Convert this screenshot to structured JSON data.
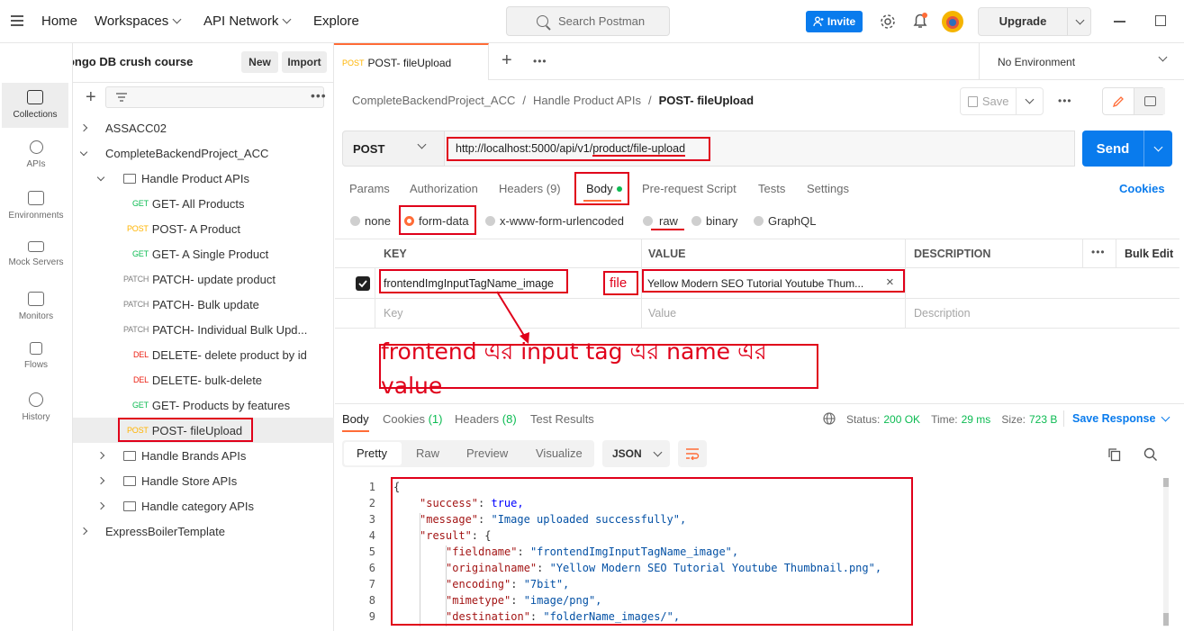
{
  "topbar": {
    "nav": [
      "Home",
      "Workspaces",
      "API Network",
      "Explore"
    ],
    "search_placeholder": "Search Postman",
    "invite": "Invite",
    "upgrade": "Upgrade"
  },
  "workspace": {
    "name": "Node Mongo DB crush course",
    "new": "New",
    "import": "Import"
  },
  "rail": [
    "Collections",
    "APIs",
    "Environments",
    "Mock Servers",
    "Monitors",
    "Flows",
    "History"
  ],
  "tree": [
    {
      "type": "collection",
      "label": "ASSACC02",
      "expanded": false
    },
    {
      "type": "collection",
      "label": "CompleteBackendProject_ACC",
      "expanded": true
    },
    {
      "type": "folder",
      "label": "Handle Product APIs",
      "expanded": true
    },
    {
      "type": "request",
      "method": "GET",
      "label": "GET- All Products"
    },
    {
      "type": "request",
      "method": "POST",
      "label": "POST- A Product"
    },
    {
      "type": "request",
      "method": "GET",
      "label": "GET- A Single Product"
    },
    {
      "type": "request",
      "method": "PATCH",
      "label": "PATCH- update product"
    },
    {
      "type": "request",
      "method": "PATCH",
      "label": "PATCH- Bulk update"
    },
    {
      "type": "request",
      "method": "PATCH",
      "label": "PATCH- Individual Bulk Upd..."
    },
    {
      "type": "request",
      "method": "DEL",
      "label": "DELETE- delete product by id"
    },
    {
      "type": "request",
      "method": "DEL",
      "label": "DELETE- bulk-delete"
    },
    {
      "type": "request",
      "method": "GET",
      "label": "GET- Products by features"
    },
    {
      "type": "request",
      "method": "POST",
      "label": "POST- fileUpload"
    },
    {
      "type": "folder",
      "label": "Handle Brands APIs",
      "expanded": false
    },
    {
      "type": "folder",
      "label": "Handle Store APIs",
      "expanded": false
    },
    {
      "type": "folder",
      "label": "Handle category APIs",
      "expanded": false
    },
    {
      "type": "collection",
      "label": "ExpressBoilerTemplate",
      "expanded": false
    }
  ],
  "tab": {
    "method": "POST",
    "title": "POST- fileUpload"
  },
  "environment": "No Environment",
  "breadcrumb": [
    "CompleteBackendProject_ACC",
    "Handle Product APIs",
    "POST- fileUpload"
  ],
  "save": "Save",
  "request": {
    "method": "POST",
    "url_prefix": "http://localhost:5000/api/v1/",
    "url_path": "product/file-upload",
    "send": "Send"
  },
  "subtabs": [
    "Params",
    "Authorization",
    "Headers (9)",
    "Body",
    "Pre-request Script",
    "Tests",
    "Settings"
  ],
  "cookies": "Cookies",
  "body_modes": [
    "none",
    "form-data",
    "x-www-form-urlencoded",
    "raw",
    "binary",
    "GraphQL"
  ],
  "table": {
    "headers": [
      "KEY",
      "VALUE",
      "DESCRIPTION",
      "Bulk Edit"
    ],
    "row": {
      "key": "frontendImgInputTagName_image",
      "type": "file",
      "value": "Yellow Modern SEO Tutorial Youtube Thum..."
    },
    "placeholders": [
      "Key",
      "Value",
      "Description"
    ]
  },
  "annotation": "frontend এর input tag এর name এর value",
  "response": {
    "tabs": [
      "Body",
      "Cookies",
      "(1)",
      "Headers",
      "(8)",
      "Test Results"
    ],
    "status_label": "Status:",
    "status": "200 OK",
    "time_label": "Time:",
    "time": "29 ms",
    "size_label": "Size:",
    "size": "723 B",
    "save_response": "Save Response",
    "views": [
      "Pretty",
      "Raw",
      "Preview",
      "Visualize"
    ],
    "format": "JSON"
  },
  "code": [
    {
      "n": "1",
      "indent": 0,
      "key": "",
      "val": "{",
      "vtype": "p"
    },
    {
      "n": "2",
      "indent": 1,
      "key": "\"success\"",
      "val": "true,",
      "vtype": "b"
    },
    {
      "n": "3",
      "indent": 1,
      "key": "\"message\"",
      "val": "\"Image uploaded successfully\",",
      "vtype": "s"
    },
    {
      "n": "4",
      "indent": 1,
      "key": "\"result\"",
      "val": "{",
      "vtype": "p"
    },
    {
      "n": "5",
      "indent": 2,
      "key": "\"fieldname\"",
      "val": "\"frontendImgInputTagName_image\",",
      "vtype": "s"
    },
    {
      "n": "6",
      "indent": 2,
      "key": "\"originalname\"",
      "val": "\"Yellow Modern SEO Tutorial Youtube Thumbnail.png\",",
      "vtype": "s"
    },
    {
      "n": "7",
      "indent": 2,
      "key": "\"encoding\"",
      "val": "\"7bit\",",
      "vtype": "s"
    },
    {
      "n": "8",
      "indent": 2,
      "key": "\"mimetype\"",
      "val": "\"image/png\",",
      "vtype": "s"
    },
    {
      "n": "9",
      "indent": 2,
      "key": "\"destination\"",
      "val": "\"folderName_images/\",",
      "vtype": "s"
    }
  ],
  "colors": {
    "accent": "#097bed",
    "orange": "#ff6c37",
    "annotation_red": "#e0001a",
    "get": "#0cbb52",
    "post": "#ffb400",
    "delete": "#eb2013"
  }
}
